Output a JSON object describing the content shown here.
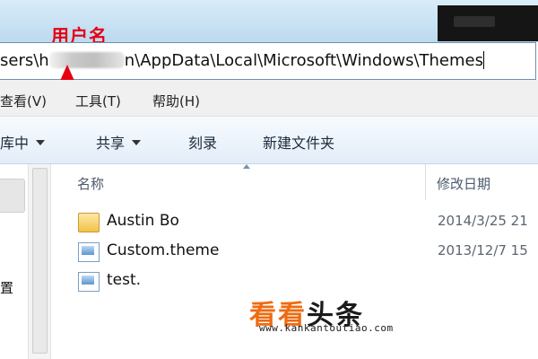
{
  "annotation": {
    "label": "用户名"
  },
  "address_bar": {
    "prefix": "sers\\",
    "obscured_start": "h",
    "obscured_end": "n",
    "suffix": "\\AppData\\Local\\Microsoft\\Windows\\Themes"
  },
  "menu": {
    "items": [
      "查看(V)",
      "工具(T)",
      "帮助(H)"
    ]
  },
  "toolbar": {
    "items": [
      "库中",
      "共享",
      "刻录",
      "新建文件夹"
    ]
  },
  "columns": {
    "name": "名称",
    "date_modified": "修改日期"
  },
  "nav": {
    "partial_label": "置"
  },
  "files": [
    {
      "name": "Austin Bo",
      "date": "2014/3/25 21",
      "icon": "folder-icon"
    },
    {
      "name": "Custom.theme",
      "date": "2013/12/7 15",
      "icon": "theme-file-icon"
    },
    {
      "name": "test.",
      "date": "",
      "icon": "theme-file-icon"
    }
  ],
  "watermark": {
    "part1": "看看",
    "part2": "头条",
    "url": "www.kankantoutiao.com"
  },
  "colors": {
    "annotation": "#e60012",
    "watermark_orange": "#ee6b12"
  }
}
